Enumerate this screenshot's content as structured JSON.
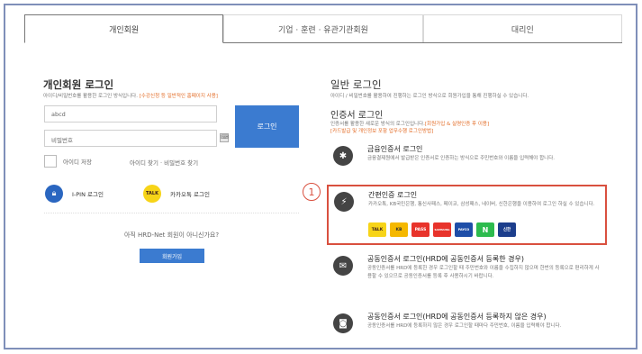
{
  "tabs": [
    {
      "label": "개인회원",
      "active": true
    },
    {
      "label": "기업 · 훈련 · 유관기관회원",
      "active": false
    },
    {
      "label": "대리인",
      "active": false
    }
  ],
  "left": {
    "title": "개인회원 로그인",
    "subtitle": "아이디/비밀번호를 활용한 로그인 방식입니다.",
    "subtitle_highlight": "[수강신청 등 일반적인 홈페이지 사용]",
    "id_value": "abcd",
    "pw_placeholder": "비밀번호",
    "login_button": "로그인",
    "save_id": "아이디 저장",
    "find_links": "아이디 찾기 · 비밀번호 찾기",
    "ipin": "I-PIN 로그인",
    "kakao_icon_text": "TALK",
    "kakao": "카카오톡 로그인",
    "member_question": "아직 HRD-Net 회원이 아니신가요?",
    "join_button": "회원가입"
  },
  "right": {
    "title": "일반 로그인",
    "subtitle": "아이디 / 비밀번호를 활용하여 진행하는 로그인 방식으로 회원가입을 통해 진행하실 수 있습니다.",
    "cert_title": "인증서 로그인",
    "cert_sub": "인증서를 활용한 새로운 방식의 로그인입니다.",
    "cert_sub_highlight": "[회원가입 & 실명인증 후 이용]",
    "cert_sub2": "[카드발급 및 개인정보 포함 업무수행 로그인방법]",
    "items": [
      {
        "title": "금융인증서 로그인",
        "desc": "금융결제원에서 발급받은 인증서로 인증하는 방식으로 주민번호와 이름을 입력해야 합니다."
      },
      {
        "title": "간편인증 로그인",
        "desc": "카카오톡, KB국민은행, 통신사패스, 페이코, 삼성패스, 네이버, 신한은행을 이용하여 로그인 하실 수 있습니다."
      },
      {
        "title": "공동인증서 로그인(HRD에 공동인증서 등록한 경우)",
        "desc": "공동인증서를 HRD에 등록한 경우 로그인할 때 주민번호와 이름을 수집하지 않으며 한번의 등록으로 편리하게 사용할 수 있으므로 공동인증서를 등록 후 사용하시기 바랍니다."
      },
      {
        "title": "공동인증서 로그인(HRD에 공동인증서 등록하지 않은 경우)",
        "desc": "공동인증서를 HRD에 등록하지 않은 경우 로그인할 때마다 주민번호, 이름을 입력해야 합니다."
      }
    ],
    "badge": "1",
    "providers": [
      {
        "name": "TALK",
        "color": "#f7d418",
        "text_color": "#3a1d1d"
      },
      {
        "name": "KB",
        "color": "#f5b800",
        "text_color": "#333333"
      },
      {
        "name": "PASS",
        "color": "#e8332b",
        "text_color": "#ffffff"
      },
      {
        "name": "SAMSUNG",
        "color": "#e8332b",
        "text_color": "#ffffff"
      },
      {
        "name": "PAYCO",
        "color": "#1e4ea8",
        "text_color": "#ffffff"
      },
      {
        "name": "N",
        "color": "#2dbb4e",
        "text_color": "#ffffff"
      },
      {
        "name": "신한",
        "color": "#1c3e8c",
        "text_color": "#ffffff"
      }
    ]
  },
  "colors": {
    "primary": "#3b7bd0",
    "highlight": "#d9503f",
    "accent": "#e36b25"
  }
}
